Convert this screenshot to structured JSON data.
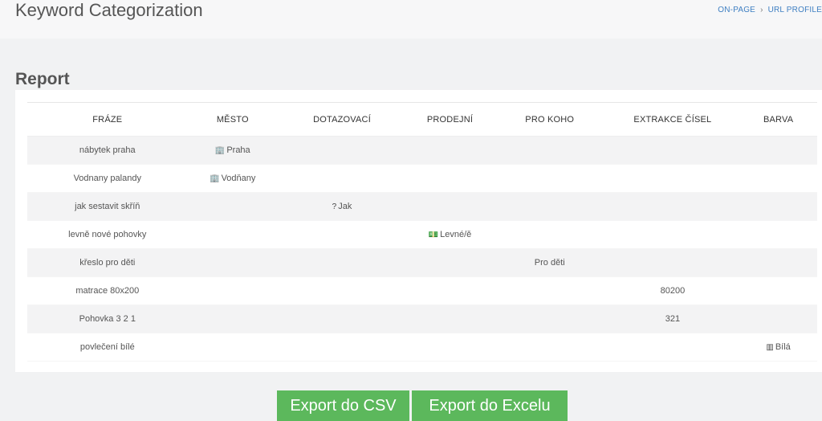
{
  "header": {
    "title": "Keyword Categorization",
    "breadcrumb": [
      "ON-PAGE",
      "URL PROFILE"
    ],
    "breadcrumb_sep": "›"
  },
  "report": {
    "title": "Report",
    "columns": [
      "FRÁZE",
      "MĚSTO",
      "DOTAZOVACÍ",
      "PRODEJNÍ",
      "PRO KOHO",
      "EXTRAKCE ČÍSEL",
      "BARVA"
    ],
    "rows": [
      {
        "phrase": "nábytek praha",
        "city": "Praha",
        "city_icon": "building-icon",
        "question": "",
        "sales": "",
        "for_whom": "",
        "numbers": "",
        "color": ""
      },
      {
        "phrase": "Vodnany palandy",
        "city": "Vodňany",
        "city_icon": "building-icon",
        "question": "",
        "sales": "",
        "for_whom": "",
        "numbers": "",
        "color": ""
      },
      {
        "phrase": "jak sestavit skříň",
        "city": "",
        "question": "Jak",
        "question_icon": "question-icon",
        "sales": "",
        "for_whom": "",
        "numbers": "",
        "color": ""
      },
      {
        "phrase": "levně nové pohovky",
        "city": "",
        "question": "",
        "sales": "Levné/ě",
        "sales_icon": "money-icon",
        "for_whom": "",
        "numbers": "",
        "color": ""
      },
      {
        "phrase": "křeslo pro děti",
        "city": "",
        "question": "",
        "sales": "",
        "for_whom": "Pro děti",
        "numbers": "",
        "color": ""
      },
      {
        "phrase": "matrace 80x200",
        "city": "",
        "question": "",
        "sales": "",
        "for_whom": "",
        "numbers": "80200",
        "color": ""
      },
      {
        "phrase": "Pohovka 3 2 1",
        "city": "",
        "question": "",
        "sales": "",
        "for_whom": "",
        "numbers": "321",
        "color": ""
      },
      {
        "phrase": "povlečení bílé",
        "city": "",
        "question": "",
        "sales": "",
        "for_whom": "",
        "numbers": "",
        "color": "Bílá",
        "color_icon": "barcode-icon"
      }
    ]
  },
  "actions": {
    "export_csv": "Export do CSV",
    "export_excel": "Export do Excelu"
  },
  "icons": {
    "building-icon": "🏢",
    "question-icon": "?",
    "money-icon": "💵",
    "barcode-icon": "▥"
  },
  "colors": {
    "accent_green": "#5cb85c",
    "link_blue": "#3f7fc2"
  }
}
